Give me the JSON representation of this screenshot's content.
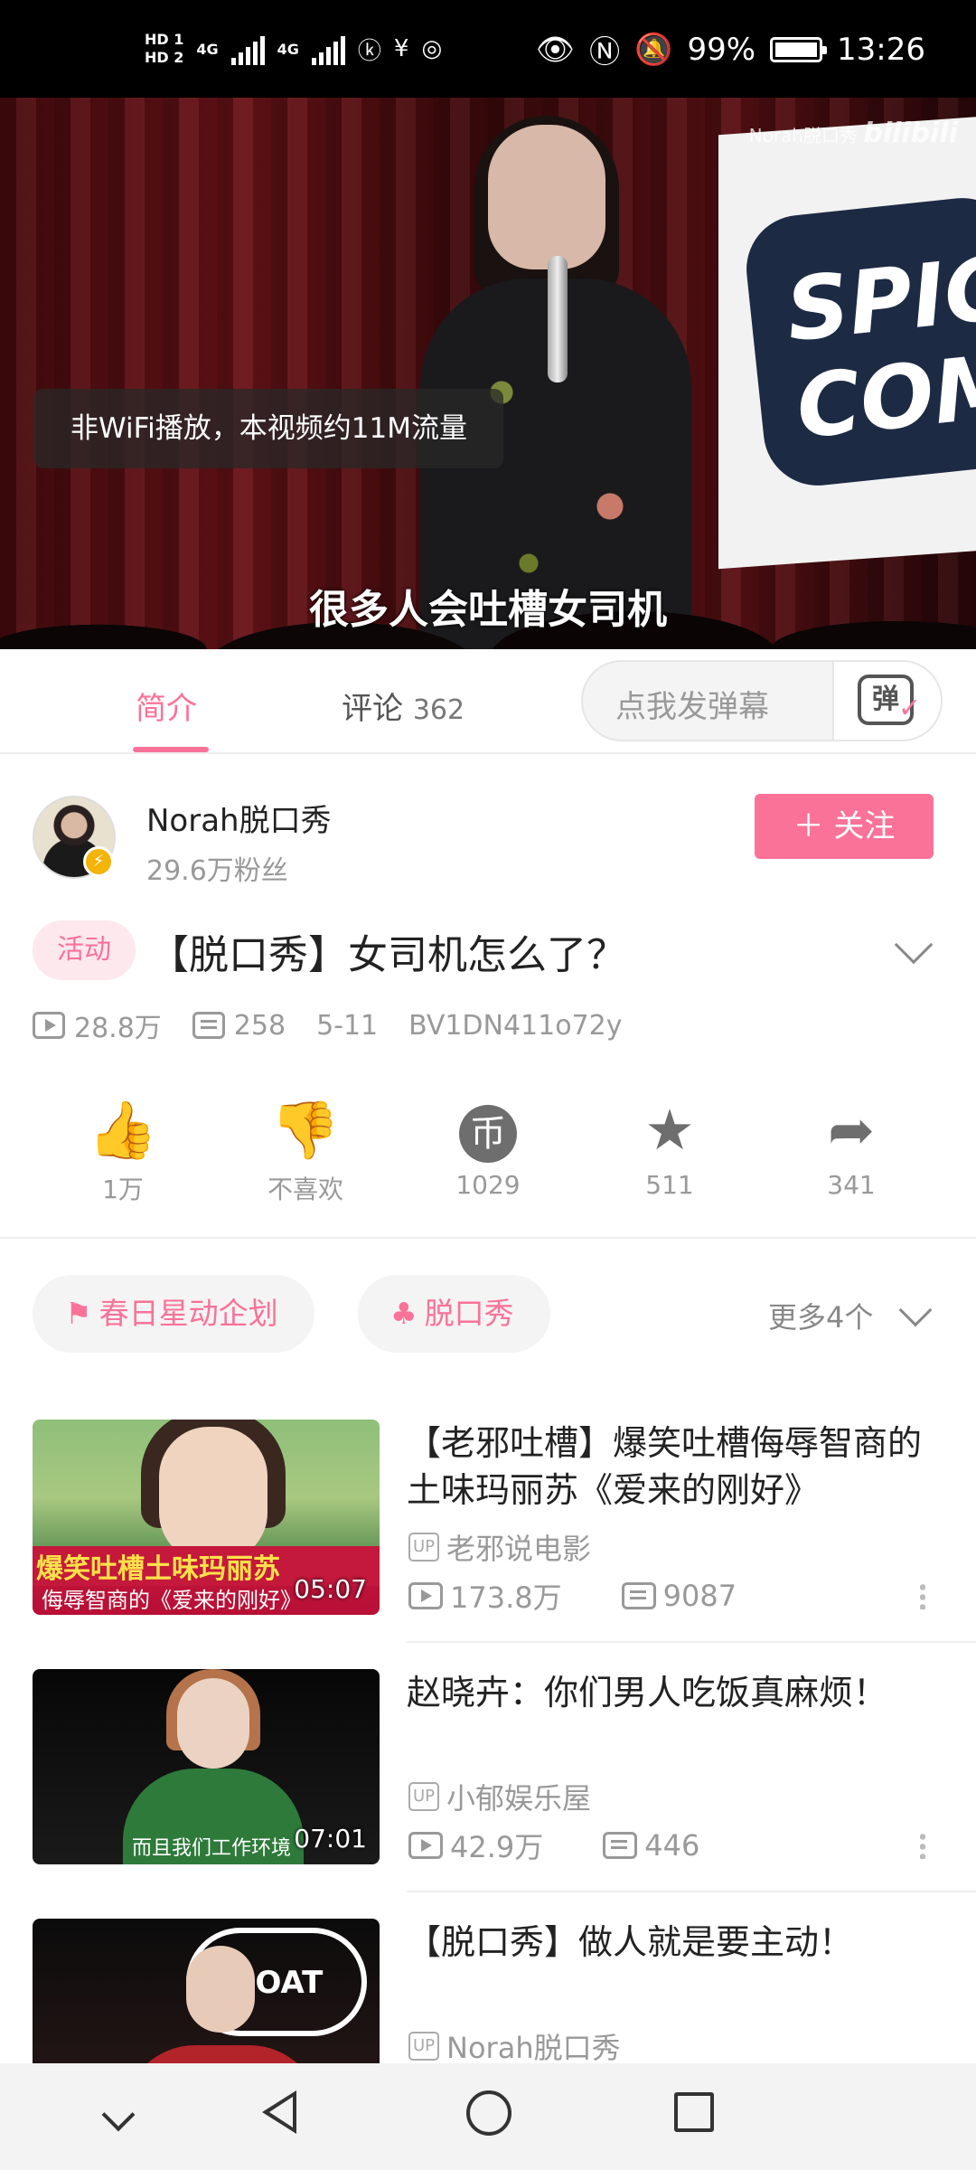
{
  "status_bar": {
    "hd1": "HD 1",
    "hd2": "HD 2",
    "net1": "4G",
    "net2": "4G",
    "battery": "99%",
    "time": "13:26"
  },
  "video": {
    "watermark_name": "Norah脱口秀",
    "watermark_logo": "bilibili",
    "sign_text": "SPIC COME",
    "network_toast": "非WiFi播放，本视频约11M流量",
    "subtitle": "很多人会吐槽女司机"
  },
  "tabs": {
    "intro_label": "简介",
    "comments_label": "评论",
    "comments_count": "362",
    "danmaku_placeholder": "点我发弹幕",
    "danmaku_icon_char": "弹"
  },
  "uploader": {
    "name": "Norah脱口秀",
    "fans": "29.6万粉丝",
    "follow_label": "＋ 关注"
  },
  "video_info": {
    "tag": "活动",
    "title": "【脱口秀】女司机怎么了？",
    "views": "28.8万",
    "danmaku_count": "258",
    "date": "5-11",
    "bvid": "BV1DN411o72y"
  },
  "actions": [
    {
      "label": "1万",
      "icon": "thumbs-up-icon"
    },
    {
      "label": "不喜欢",
      "icon": "thumbs-down-icon"
    },
    {
      "label": "1029",
      "icon": "coin-icon"
    },
    {
      "label": "511",
      "icon": "star-icon"
    },
    {
      "label": "341",
      "icon": "share-icon"
    }
  ],
  "topics": {
    "topic1": "春日星动企划",
    "topic2": "脱口秀",
    "more": "更多4个"
  },
  "related": [
    {
      "title": "【老邪吐槽】爆笑吐槽侮辱智商的土味玛丽苏《爱来的刚好》",
      "uploader": "老邪说电影",
      "views": "173.8万",
      "danmaku": "9087",
      "duration": "05:07",
      "thumb_caption": "爆笑吐槽土味玛丽苏",
      "thumb_caption2": "侮辱智商的《爱来的刚好》"
    },
    {
      "title": "赵晓卉：你们男人吃饭真麻烦！",
      "uploader": "小郁娱乐屋",
      "views": "42.9万",
      "danmaku": "446",
      "duration": "07:01",
      "thumb_caption": "而且我们工作环境"
    },
    {
      "title": "【脱口秀】做人就是要主动！",
      "uploader": "Norah脱口秀",
      "thumb_text": "GOAT"
    }
  ],
  "up_label": "UP"
}
